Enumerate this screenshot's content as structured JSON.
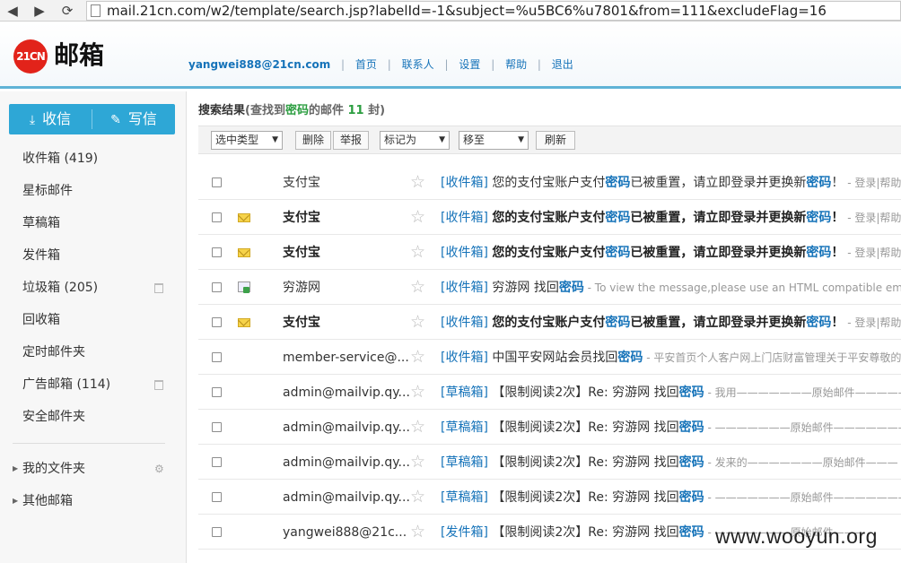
{
  "browser": {
    "url": "mail.21cn.com/w2/template/search.jsp?labelId=-1&subject=%u5BC6%u7801&from=111&excludeFlag=16"
  },
  "header": {
    "logo_badge": "21CN",
    "logo_text": "邮箱",
    "user": "yangwei888@21cn.com",
    "nav": [
      "首页",
      "联系人",
      "设置",
      "帮助",
      "退出"
    ]
  },
  "sidebar": {
    "receive": "收信",
    "write": "写信",
    "folders": [
      "收件箱 (419)",
      "星标邮件",
      "草稿箱",
      "发件箱",
      "垃圾箱 (205)",
      "回收箱",
      "定时邮件夹",
      "广告邮箱 (114)",
      "安全邮件夹"
    ],
    "groups": [
      "我的文件夹",
      "其他邮箱"
    ]
  },
  "search": {
    "title": "搜索结果",
    "open": "(查找到",
    "keyword": "密码",
    "mid": "的邮件 ",
    "count": "11",
    "close": " 封)"
  },
  "toolbar": {
    "select_type": "选中类型",
    "delete": "删除",
    "report": "举报",
    "mark_as": "标记为",
    "move_to": "移至",
    "refresh": "刷新"
  },
  "mails": [
    {
      "sender": "支付宝",
      "tag": "[收件箱]",
      "s1": "您的支付宝账户支付",
      "kw": "密码",
      "s2": "已被重置，请立即登录并更换新",
      "kw2": "密码",
      "s3": "！",
      "preview": " - 登录|帮助"
    },
    {
      "sender": "支付宝",
      "tag": "[收件箱]",
      "s1": "您的支付宝账户支付",
      "kw": "密码",
      "s2": "已被重置，请立即登录并更换新",
      "kw2": "密码",
      "s3": "！",
      "preview": " - 登录|帮助"
    },
    {
      "sender": "支付宝",
      "tag": "[收件箱]",
      "s1": "您的支付宝账户支付",
      "kw": "密码",
      "s2": "已被重置，请立即登录并更换新",
      "kw2": "密码",
      "s3": "！",
      "preview": " - 登录|帮助"
    },
    {
      "sender": "穷游网",
      "tag": "[收件箱]",
      "s1": "穷游网  找回",
      "kw": "密码",
      "s2": "",
      "kw2": "",
      "s3": "",
      "preview": " - To view the message,please use an HTML compatible email viewer"
    },
    {
      "sender": "支付宝",
      "tag": "[收件箱]",
      "s1": "您的支付宝账户支付",
      "kw": "密码",
      "s2": "已被重置，请立即登录并更换新",
      "kw2": "密码",
      "s3": "！",
      "preview": " - 登录|帮助"
    },
    {
      "sender": "member-service@...",
      "tag": "[收件箱]",
      "s1": "中国平安网站会员找回",
      "kw": "密码",
      "s2": "",
      "kw2": "",
      "s3": "",
      "preview": " - 平安首页个人客户网上门店财富管理关于平安尊敬的"
    },
    {
      "sender": "admin@mailvip.qy...",
      "tag": "[草稿箱]",
      "s1": "【限制阅读2次】Re: 穷游网 找回",
      "kw": "密码",
      "s2": "",
      "kw2": "",
      "s3": "",
      "preview": " - 我用———————原始邮件———————"
    },
    {
      "sender": "admin@mailvip.qy...",
      "tag": "[草稿箱]",
      "s1": "【限制阅读2次】Re: 穷游网 找回",
      "kw": "密码",
      "s2": "",
      "kw2": "",
      "s3": "",
      "preview": " - ———————原始邮件———————发件"
    },
    {
      "sender": "admin@mailvip.qy...",
      "tag": "[草稿箱]",
      "s1": "【限制阅读2次】Re: 穷游网 找回",
      "kw": "密码",
      "s2": "",
      "kw2": "",
      "s3": "",
      "preview": " - 发来的———————原始邮件———"
    },
    {
      "sender": "admin@mailvip.qy...",
      "tag": "[草稿箱]",
      "s1": "【限制阅读2次】Re: 穷游网 找回",
      "kw": "密码",
      "s2": "",
      "kw2": "",
      "s3": "",
      "preview": " - ———————原始邮件———————发件"
    },
    {
      "sender": "yangwei888@21c...",
      "tag": "[发件箱]",
      "s1": "【限制阅读2次】Re: 穷游网 找回",
      "kw": "密码",
      "s2": "",
      "kw2": "",
      "s3": "",
      "preview": " - ———————原始邮件———"
    }
  ],
  "watermark": "www.wooyun.org"
}
